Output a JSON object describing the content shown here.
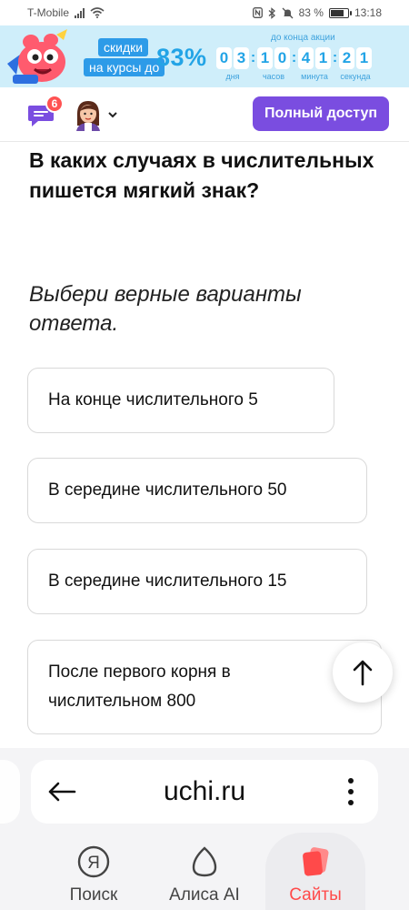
{
  "status_bar": {
    "carrier": "T-Mobile",
    "battery_text": "83 %",
    "battery_level": 0.83,
    "time": "13:18",
    "icons": [
      "signal-icon",
      "wifi-icon",
      "nfc-icon",
      "bluetooth-icon",
      "mute-icon",
      "battery-icon"
    ]
  },
  "promo": {
    "line1": "скидки",
    "line2": "на курсы до",
    "percent": "83%",
    "until_label": "до конца акции",
    "timer": {
      "days": [
        "0",
        "3"
      ],
      "hours": [
        "1",
        "0"
      ],
      "minutes": [
        "4",
        "1"
      ],
      "seconds": [
        "2",
        "1"
      ],
      "days_label": "дня",
      "hours_label": "часов",
      "minutes_label": "минута",
      "seconds_label": "секунда"
    },
    "colors": {
      "background": "#cfeefa",
      "accent": "#23a4e6",
      "label_bg": "#2d9be8"
    }
  },
  "header": {
    "notifications_count": "6",
    "full_access_label": "Полный доступ",
    "icons": [
      "chat-icon",
      "avatar",
      "chevron-down-icon"
    ],
    "colors": {
      "button": "#7a4de0",
      "badge": "#ff5252"
    }
  },
  "content": {
    "question": "В каких случаях в числительных пишется мягкий знак?",
    "instruction": "Выбери верные варианты ответа.",
    "options": [
      {
        "label": "На конце числительного 5"
      },
      {
        "label": "В середине числительного 50"
      },
      {
        "label": "В середине числительного 15"
      },
      {
        "label": "После первого корня в числительном 800"
      }
    ]
  },
  "browser": {
    "url": "uchi.ru",
    "nav": [
      {
        "label": "Поиск",
        "icon": "yandex-search-icon",
        "active": false
      },
      {
        "label": "Алиса AI",
        "icon": "alice-icon",
        "active": false
      },
      {
        "label": "Сайты",
        "icon": "sites-icon",
        "active": true
      }
    ],
    "colors": {
      "active": "#ff4a4a"
    }
  }
}
